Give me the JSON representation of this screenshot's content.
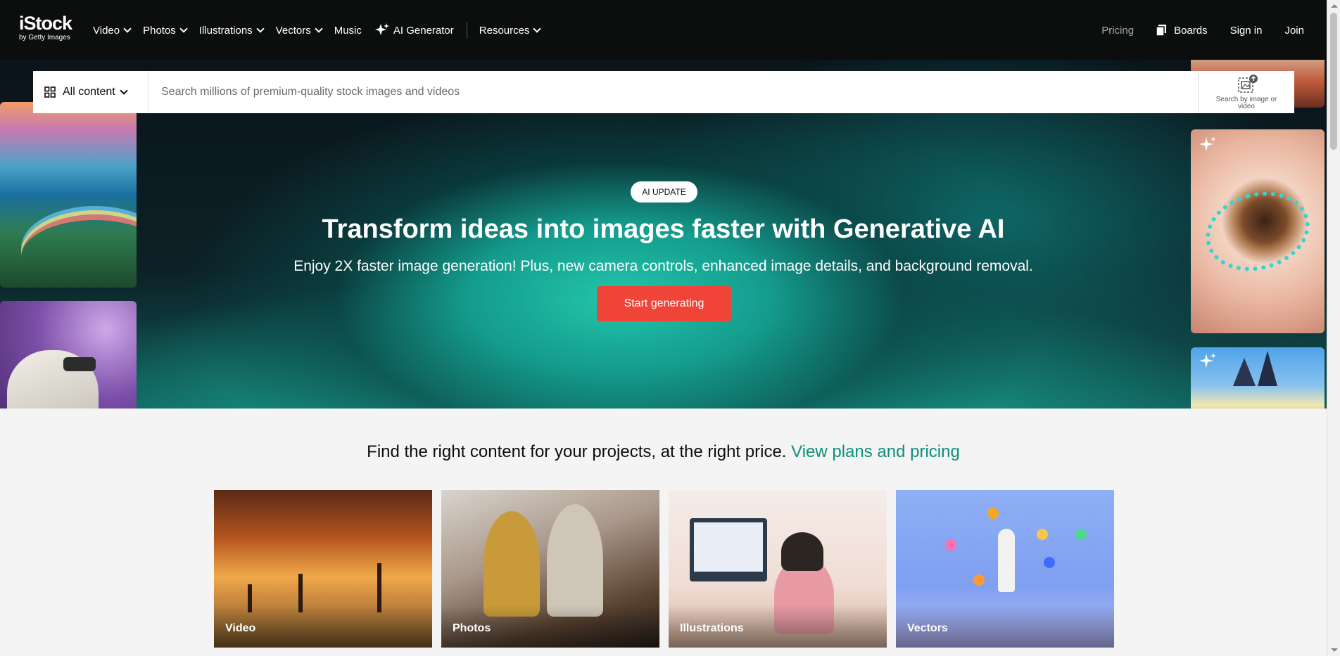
{
  "brand": {
    "logo": "iStock",
    "logo_sub": "by Getty Images"
  },
  "nav": {
    "left": [
      {
        "label": "Video"
      },
      {
        "label": "Photos"
      },
      {
        "label": "Illustrations"
      },
      {
        "label": "Vectors"
      },
      {
        "label": "Music"
      },
      {
        "label": "AI Generator"
      },
      {
        "label": "Resources"
      }
    ],
    "right": {
      "pricing": "Pricing",
      "boards": "Boards",
      "signin": "Sign in",
      "join": "Join"
    }
  },
  "search": {
    "content_filter": "All content",
    "placeholder": "Search millions of premium-quality stock images and videos",
    "value": "",
    "image_search_label": "Search by image or video"
  },
  "hero": {
    "badge": "AI UPDATE",
    "title": "Transform ideas into images faster with Generative AI",
    "subtitle": "Enjoy 2X faster image generation! Plus, new camera controls, enhanced image details, and background removal.",
    "cta": "Start generating"
  },
  "tagline": {
    "text": "Find the right content for your projects, at the right price. ",
    "link": "View plans and pricing"
  },
  "categories": [
    {
      "label": "Video"
    },
    {
      "label": "Photos"
    },
    {
      "label": "Illustrations"
    },
    {
      "label": "Vectors"
    }
  ],
  "colors": {
    "nav_bg": "#0c0d0d",
    "cta": "#f04438",
    "link": "#0f8f7a",
    "page_bg": "#f4f4f4"
  }
}
